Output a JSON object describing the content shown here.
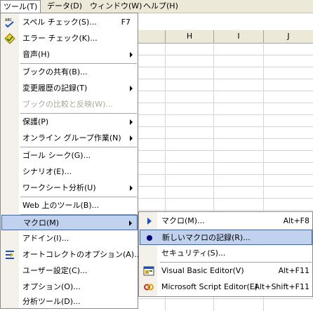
{
  "menubar": {
    "items": [
      "ツール(T)",
      "データ(D)",
      "ウィンドウ(W)",
      "ヘルプ(H)"
    ]
  },
  "sheet": {
    "columns": [
      "H",
      "I",
      "J"
    ]
  },
  "tools_menu": {
    "items": [
      {
        "label": "スペル チェック(S)...",
        "shortcut": "F7",
        "icon": "spell-check-icon"
      },
      {
        "label": "エラー チェック(K)...",
        "icon": "error-check-icon"
      },
      {
        "label": "音声(H)"
      },
      {
        "label": "ブックの共有(B)..."
      },
      {
        "label": "変更履歴の記録(T)"
      },
      {
        "label": "ブックの比較と反映(W)..."
      },
      {
        "label": "保護(P)"
      },
      {
        "label": "オンライン グループ作業(N)"
      },
      {
        "label": "ゴール シーク(G)..."
      },
      {
        "label": "シナリオ(E)..."
      },
      {
        "label": "ワークシート分析(U)"
      },
      {
        "label": "Web 上のツール(B)..."
      },
      {
        "label": "マクロ(M)"
      },
      {
        "label": "アドイン(I)..."
      },
      {
        "label": "オートコレクトのオプション(A)...",
        "icon": "autocorrect-icon"
      },
      {
        "label": "ユーザー設定(C)..."
      },
      {
        "label": "オプション(O)..."
      },
      {
        "label": "分析ツール(D)..."
      }
    ]
  },
  "macro_submenu": {
    "items": [
      {
        "label": "マクロ(M)...",
        "shortcut": "Alt+F8",
        "icon": "play-icon"
      },
      {
        "label": "新しいマクロの記録(R)...",
        "icon": "record-icon"
      },
      {
        "label": "セキュリティ(S)..."
      },
      {
        "label": "Visual Basic Editor(V)",
        "shortcut": "Alt+F11",
        "icon": "vb-editor-icon"
      },
      {
        "label": "Microsoft Script Editor(E)",
        "shortcut": "Alt+Shift+F11",
        "icon": "script-editor-icon"
      }
    ]
  }
}
